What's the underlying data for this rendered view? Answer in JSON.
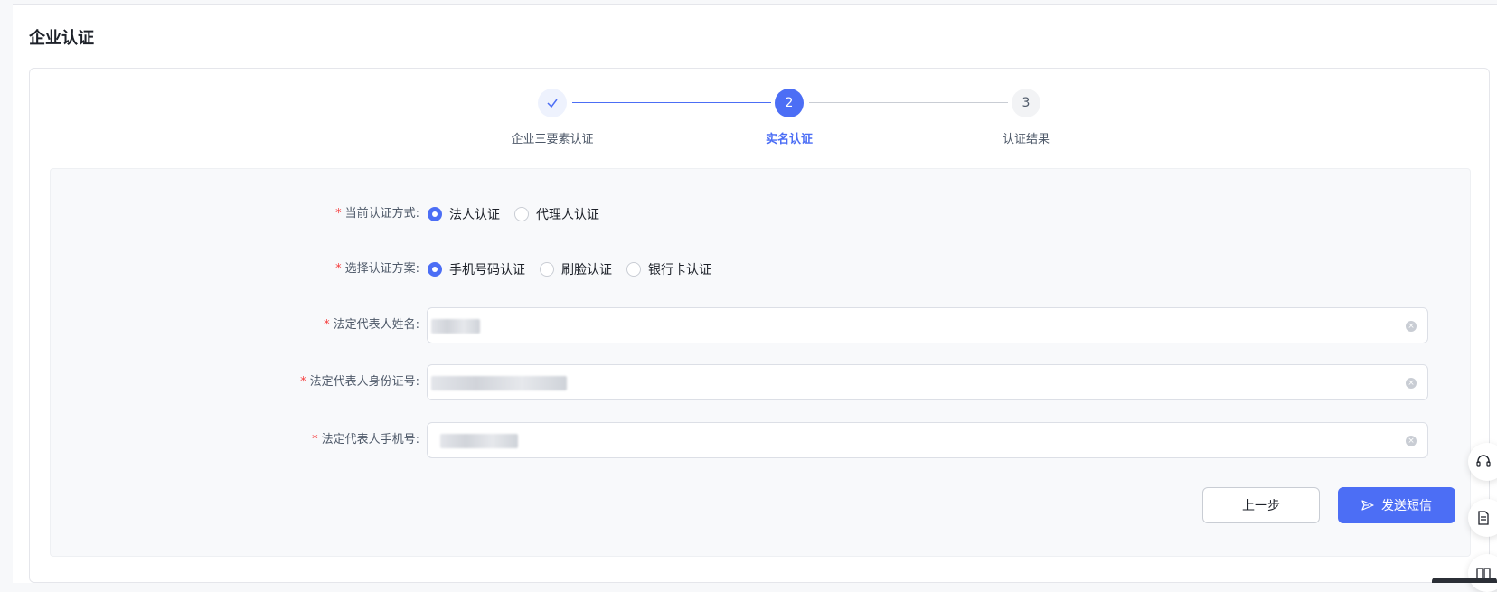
{
  "page": {
    "title": "企业认证"
  },
  "steps": [
    {
      "number": "✓",
      "label": "企业三要素认证",
      "status": "done"
    },
    {
      "number": "2",
      "label": "实名认证",
      "status": "active"
    },
    {
      "number": "3",
      "label": "认证结果",
      "status": "pending"
    }
  ],
  "form": {
    "auth_method": {
      "label": "当前认证方式:",
      "options": [
        "法人认证",
        "代理人认证"
      ],
      "selected": "法人认证"
    },
    "auth_plan": {
      "label": "选择认证方案:",
      "options": [
        "手机号码认证",
        "刷脸认证",
        "银行卡认证"
      ],
      "selected": "手机号码认证"
    },
    "legal_name": {
      "label": "法定代表人姓名:"
    },
    "legal_id": {
      "label": "法定代表人身份证号:"
    },
    "legal_phone": {
      "label": "法定代表人手机号:"
    },
    "required_mark": "*"
  },
  "buttons": {
    "prev": "上一步",
    "send": "发送短信"
  },
  "colors": {
    "primary": "#4c6ef5",
    "required": "#f53f3f"
  },
  "icons": [
    "check-icon",
    "clear-icon",
    "send-icon",
    "headset-icon",
    "document-icon",
    "book-icon"
  ]
}
